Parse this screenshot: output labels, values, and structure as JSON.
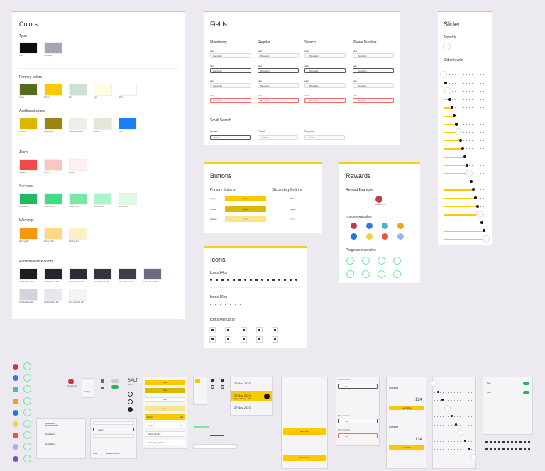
{
  "colors": {
    "title": "Colors",
    "typo": {
      "label": "Typo",
      "items": [
        {
          "name": "Main",
          "hex": "#0d0d0d"
        },
        {
          "name": "Secondary",
          "hex": "#a6a5b1"
        }
      ]
    },
    "primary": {
      "label": "Primary colors",
      "items": [
        {
          "name": "Green",
          "hex": "#556b1f"
        },
        {
          "name": "Primary",
          "hex": "#fcc800"
        },
        {
          "name": "Mint",
          "hex": "#c9e3d0"
        },
        {
          "name": "Light",
          "hex": "#fdfde0"
        },
        {
          "name": "White",
          "hex": "#ffffff"
        }
      ]
    },
    "additional": {
      "label": "Additional colors",
      "items": [
        {
          "name": "Pressed",
          "hex": "#ddb800"
        },
        {
          "name": "Dark Yellow",
          "hex": "#9d8410"
        },
        {
          "name": "Additional Pressed",
          "hex": "#eaf0e4"
        },
        {
          "name": "Borders",
          "hex": "#e6e6d8"
        },
        {
          "name": "Links",
          "hex": "#1b7ff3"
        }
      ]
    },
    "alerts": {
      "label": "Alerts",
      "items": [
        {
          "name": "Start Err",
          "hex": "#f24a4a"
        },
        {
          "name": "Bck Err",
          "hex": "#fbc5c2"
        },
        {
          "name": "Border",
          "hex": "#fef0ef"
        }
      ]
    },
    "success": {
      "label": "Success",
      "items": [
        {
          "name": "Success 500",
          "hex": "#20b962"
        },
        {
          "name": "Success 400",
          "hex": "#3fdc84"
        },
        {
          "name": "Success 300",
          "hex": "#77e8a6"
        },
        {
          "name": "Success 200",
          "hex": "#adf5c9"
        },
        {
          "name": "Success 100",
          "hex": "#dcfbe7"
        }
      ]
    },
    "warnings": {
      "label": "Warnings",
      "items": [
        {
          "name": "Warning 500",
          "hex": "#fa9514"
        },
        {
          "name": "Warning 300",
          "hex": "#fdd984"
        },
        {
          "name": "Warning 100",
          "hex": "#fdf0c9"
        }
      ]
    },
    "dark": {
      "label": "Additional dark colors",
      "items": [
        {
          "name": "Dark Additional 900",
          "hex": "#1e1d23"
        },
        {
          "name": "Dark Additional 800",
          "hex": "#26252c"
        },
        {
          "name": "Dark Additional 700",
          "hex": "#2d2c36"
        },
        {
          "name": "Dark Additional 600",
          "hex": "#35343e"
        },
        {
          "name": "Dark Additional 500",
          "hex": "#3e3d47"
        },
        {
          "name": "Dark Additional 400",
          "hex": "#6e6d80"
        },
        {
          "name": "Dark Additional 300",
          "hex": "#d4d2dc"
        },
        {
          "name": "Dark Additional 200",
          "hex": "#e8e7ee"
        },
        {
          "name": "Dark Additional 100",
          "hex": "#f5f4f8"
        }
      ]
    }
  },
  "fields": {
    "title": "Fields",
    "columns": [
      "Mandatory",
      "Regular",
      "Search",
      "Phone Number"
    ],
    "label": "Label",
    "placeholder": "Placeholder",
    "small_search": {
      "title": "Small Search",
      "states": [
        "Active",
        "Filled",
        "Regular"
      ],
      "search_text": "Search"
    }
  },
  "slider": {
    "title": "Slider",
    "joystick": "Joystick",
    "levels_label": "Slider levels",
    "levels": [
      0,
      0.05,
      0.1,
      0.15,
      0.2,
      0.25,
      0.3,
      0.35,
      0.4,
      0.45,
      0.5,
      0.55,
      0.6,
      0.65,
      0.7,
      0.75,
      0.8,
      0.85,
      0.9,
      0.95,
      1.0
    ]
  },
  "buttons": {
    "title": "Buttons",
    "primary_title": "Primary Buttons",
    "secondary_title": "Secondary Buttons",
    "states": [
      "Regular",
      "Pressed",
      "Disabled"
    ],
    "label": "Button"
  },
  "rewards": {
    "title": "Rewards",
    "example_label": "Reward Example",
    "reward_name": "Reward Pos",
    "images_label": "Image examples",
    "progress_label": "Progress examples"
  },
  "icons": {
    "title": "Icons",
    "s24": "Icons 24px",
    "s16": "Icons 16px",
    "menubar": "Icons Menu Bar"
  },
  "mini": {
    "salt": "SALT",
    "salt_sub": "BK467",
    "btn": "Next",
    "btn2": "Sale",
    "buy_for": "Buy for",
    "price": "124",
    "status_pending": "Status: Pending",
    "status_not": "Status: Not Approved",
    "date1": "27 Nov 2023",
    "date2": "27 Nov 2023",
    "date3": "27 Nov 2023",
    "date_sub": "Payment Sent",
    "date_val": "18h",
    "phone": "Phone Number",
    "phone_val": "Text",
    "speaker": "Speaker",
    "price2": "124",
    "text": "Text",
    "search": "Search",
    "email": "Email Buttons",
    "next": "Next",
    "bp_user": "Auto Dem",
    "bp_user_sub": "Promotion Number",
    "pending_tag": "Pending",
    "go_btn": "Send Cash",
    "learn": "Learn More"
  }
}
